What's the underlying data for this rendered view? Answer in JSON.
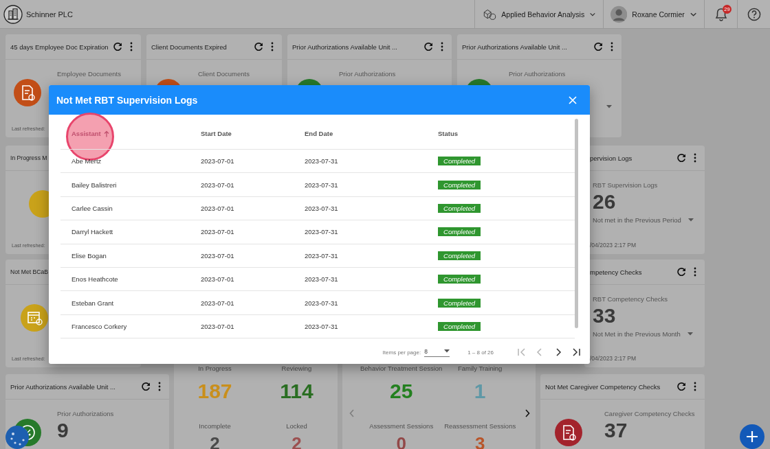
{
  "top_bar": {
    "company": "Schinner PLC",
    "program": "Applied Behavior Analysis",
    "user": "Roxane Cormier",
    "notification_count": "29"
  },
  "cards": [
    {
      "kind": "metric",
      "title": "45 days Employee Doc Expiration",
      "actions": true,
      "subtitle": "Employee Documents",
      "color": "#c24e17",
      "footer": "Last refreshed:"
    },
    {
      "kind": "metric",
      "title": "Client Documents Expired",
      "actions": true,
      "subtitle": "Client Documents",
      "color": "#c24e17"
    },
    {
      "kind": "metric",
      "title": "Prior Authorizations Available Unit ...",
      "actions": true,
      "subtitle": "Prior Authorizations",
      "color": "#277a2b"
    },
    {
      "kind": "metric",
      "title": "Prior Authorizations Available Unit ...",
      "actions": true,
      "subtitle": "Prior Authorizations",
      "color": "#277a2b",
      "dropdown": true
    },
    {
      "kind": "metric",
      "title": "In Progress M",
      "actions": false,
      "color": "#c9a21a",
      "footer": "Last refreshed:"
    },
    {
      "kind": "metric",
      "title": "pervision Logs",
      "actions": true,
      "subtitle": "RBT Supervision Logs",
      "value": "26",
      "detail": "Not met in the Previous Period",
      "dropdown": true,
      "footer": "/04/2023 2:17 PM"
    },
    {
      "kind": "metric",
      "title": "Not Met BCaB",
      "actions": false,
      "color": "#c9a21a",
      "footer": "Last refreshed:"
    },
    {
      "kind": "metric",
      "title": "mpetency Checks",
      "actions": true,
      "subtitle": "RBT Competency Checks",
      "value": "33",
      "detail": "Not Met in the Previous Month",
      "dropdown": true,
      "footer": "/04/2023 2:17 PM"
    },
    {
      "kind": "metric",
      "title": "Prior Authorizations Available Unit ...",
      "actions": true,
      "subtitle": "Prior Authorizations",
      "value": "9",
      "color": "#277a2b"
    },
    {
      "kind": "stats",
      "stats": [
        {
          "label": "In Progress",
          "value": "187",
          "color": "#c98f1c"
        },
        {
          "label": "Reviewing",
          "value": "114",
          "color": "#2a6e22"
        },
        {
          "label": "Incomplete",
          "value": "2",
          "color": "#4a4a4a"
        },
        {
          "label": "Locked",
          "value": "2",
          "color": "#9c5050"
        }
      ]
    },
    {
      "kind": "carousel",
      "prev_disabled": true,
      "next_disabled": false,
      "stats": [
        {
          "label": "Behavior Treatment Session",
          "value": "25",
          "color": "#23801f"
        },
        {
          "label": "Family Training",
          "value": "1",
          "color": "#5f98a6"
        },
        {
          "label": "Assessment Sessions",
          "value": "0",
          "color": "#924848"
        },
        {
          "label": "Reassessment Sessions",
          "value": "3",
          "color": "#b8552a"
        }
      ]
    },
    {
      "kind": "metric",
      "title": "Not Met Caregiver Competency Checks",
      "actions": true,
      "subtitle": "Caregiver Competency Checks",
      "value": "37",
      "color": "#a3232c"
    }
  ],
  "modal": {
    "title": "Not Met RBT Supervision Logs",
    "columns": [
      {
        "label": "Assistant",
        "sorted": true
      },
      {
        "label": "Start Date",
        "sorted": false
      },
      {
        "label": "End Date",
        "sorted": false
      },
      {
        "label": "Status",
        "sorted": false
      }
    ],
    "rows": [
      {
        "assistant": "Abe Mertz",
        "start_date": "2023-07-01",
        "end_date": "2023-07-31",
        "status": "Completed"
      },
      {
        "assistant": "Bailey Balistreri",
        "start_date": "2023-07-01",
        "end_date": "2023-07-31",
        "status": "Completed"
      },
      {
        "assistant": "Carlee Cassin",
        "start_date": "2023-07-01",
        "end_date": "2023-07-31",
        "status": "Completed"
      },
      {
        "assistant": "Darryl Hackett",
        "start_date": "2023-07-01",
        "end_date": "2023-07-31",
        "status": "Completed"
      },
      {
        "assistant": "Elise Bogan",
        "start_date": "2023-07-01",
        "end_date": "2023-07-31",
        "status": "Completed"
      },
      {
        "assistant": "Enos Heathcote",
        "start_date": "2023-07-01",
        "end_date": "2023-07-31",
        "status": "Completed"
      },
      {
        "assistant": "Esteban Grant",
        "start_date": "2023-07-01",
        "end_date": "2023-07-31",
        "status": "Completed"
      },
      {
        "assistant": "Francesco Corkery",
        "start_date": "2023-07-01",
        "end_date": "2023-07-31",
        "status": "Completed"
      }
    ],
    "paginator": {
      "items_per_page_label": "Items per page:",
      "page_size": "8",
      "range": "1 – 8 of 26",
      "buttons": [
        {
          "kind": "first",
          "disabled": true
        },
        {
          "kind": "prev",
          "disabled": true
        },
        {
          "kind": "next",
          "disabled": false
        },
        {
          "kind": "last",
          "disabled": false
        }
      ]
    }
  }
}
